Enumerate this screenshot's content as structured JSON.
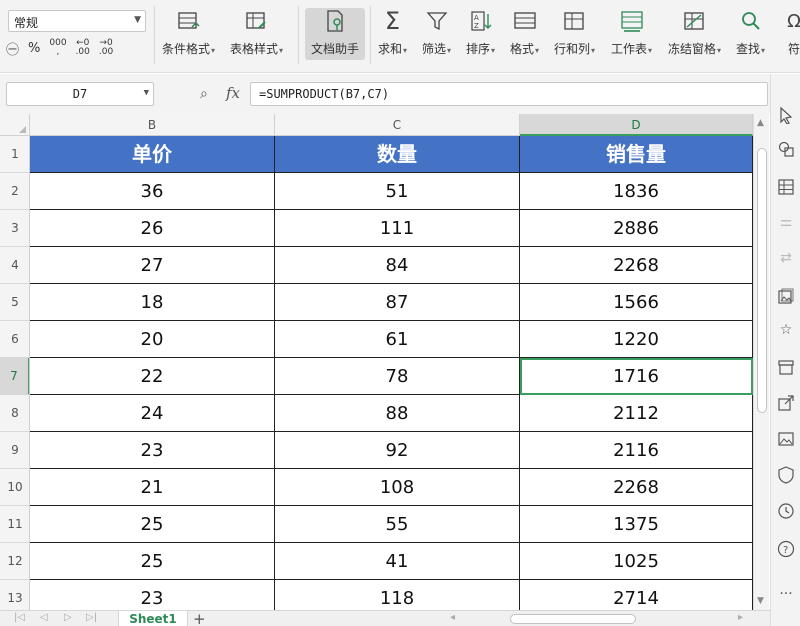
{
  "ribbon": {
    "number_format": "常规",
    "num_tools": [
      "¥",
      "%",
      "000",
      "←0 .00",
      "→0 .00"
    ],
    "buttons": {
      "conditional_format": "条件格式",
      "table_style": "表格样式",
      "doc_helper": "文档助手",
      "sum": "求和",
      "filter": "筛选",
      "sort": "排序",
      "format": "格式",
      "rows_cols": "行和列",
      "worksheet": "工作表",
      "freeze": "冻结窗格",
      "find": "查找",
      "symbol": "符"
    }
  },
  "formula_bar": {
    "name_box": "D7",
    "fx": "fx",
    "formula": "=SUMPRODUCT(B7,C7)"
  },
  "columns": [
    "B",
    "C",
    "D"
  ],
  "active_column": "D",
  "headers": [
    "单价",
    "数量",
    "销售量"
  ],
  "rows": [
    {
      "num": "1"
    },
    {
      "num": "2",
      "b": "36",
      "c": "51",
      "d": "1836"
    },
    {
      "num": "3",
      "b": "26",
      "c": "111",
      "d": "2886"
    },
    {
      "num": "4",
      "b": "27",
      "c": "84",
      "d": "2268"
    },
    {
      "num": "5",
      "b": "18",
      "c": "87",
      "d": "1566"
    },
    {
      "num": "6",
      "b": "20",
      "c": "61",
      "d": "1220"
    },
    {
      "num": "7",
      "b": "22",
      "c": "78",
      "d": "1716"
    },
    {
      "num": "8",
      "b": "24",
      "c": "88",
      "d": "2112"
    },
    {
      "num": "9",
      "b": "23",
      "c": "92",
      "d": "2116"
    },
    {
      "num": "10",
      "b": "21",
      "c": "108",
      "d": "2268"
    },
    {
      "num": "11",
      "b": "25",
      "c": "55",
      "d": "1375"
    },
    {
      "num": "12",
      "b": "25",
      "c": "41",
      "d": "1025"
    },
    {
      "num": "13",
      "b": "23",
      "c": "118",
      "d": "2714"
    }
  ],
  "active_row": "7",
  "sheet_tab": "Sheet1",
  "colors": {
    "header_fill": "#4472c4",
    "selection": "#3a9d5d",
    "tab_text": "#2e8b57"
  }
}
